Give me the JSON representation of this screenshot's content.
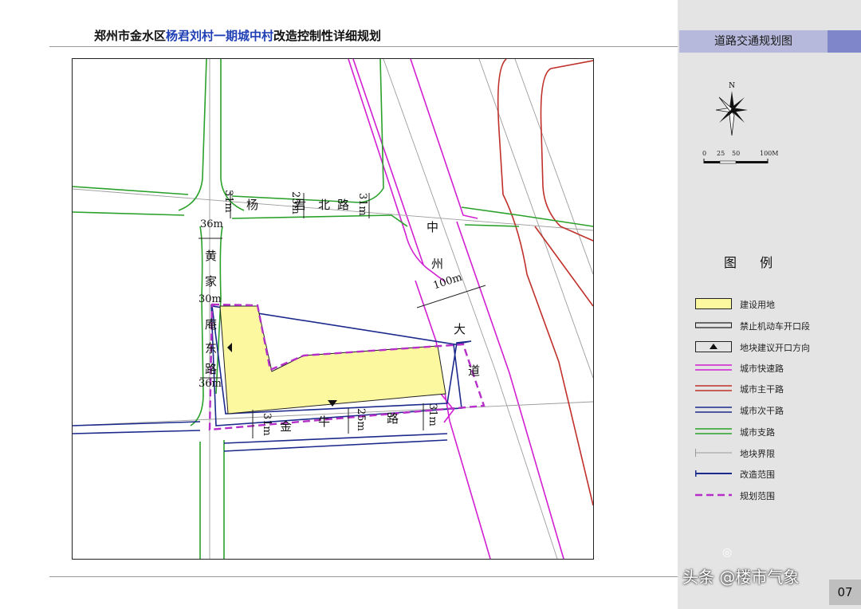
{
  "header": {
    "title_prefix": "郑州市金水区",
    "title_highlight_1": "杨君刘村一期城中村",
    "title_suffix": "改造控制性详细规划"
  },
  "sidebar": {
    "map_title": "道路交通规划图",
    "compass_label": "N",
    "scale": {
      "labels": [
        "0",
        "25",
        "50",
        "100M"
      ]
    },
    "legend_title": "图 例",
    "legend": [
      {
        "label": "建设用地",
        "icon": "yellow-fill"
      },
      {
        "label": "禁止机动车开口段",
        "icon": "double-line-black"
      },
      {
        "label": "地块建议开口方向",
        "icon": "triangle-up"
      },
      {
        "label": "城市快速路",
        "icon": "double-line-magenta"
      },
      {
        "label": "城市主干路",
        "icon": "double-line-red"
      },
      {
        "label": "城市次干路",
        "icon": "double-line-navy"
      },
      {
        "label": "城市支路",
        "icon": "double-line-green"
      },
      {
        "label": "地块界限",
        "icon": "thin-line-gray"
      },
      {
        "label": "改造范围",
        "icon": "blue-line"
      },
      {
        "label": "规划范围",
        "icon": "dashed-magenta"
      }
    ]
  },
  "map": {
    "roads": {
      "yangjun_north": [
        "杨",
        "君",
        "北",
        "路"
      ],
      "zhongzhou": [
        "中",
        "州",
        "大",
        "道"
      ],
      "huangjia": [
        "黄",
        "家",
        "庵",
        "东",
        "路"
      ],
      "jinniu": [
        "金",
        "牛",
        "路"
      ]
    },
    "dimensions": {
      "yangjun_w1": "31m",
      "yangjun_w2": "25m",
      "yangjun_w3": "31m",
      "zhongzhou_w": "100m",
      "huangjia_w1": "36m",
      "huangjia_w2": "30m",
      "huangjia_w3": "36m",
      "jinniu_w1": "31m",
      "jinniu_w2": "25m",
      "jinniu_w3": "31m"
    }
  },
  "footer": {
    "watermark": "头条 @楼市气象",
    "page_number": "07"
  },
  "colors": {
    "expressway": "#d21fd2",
    "arterial": "#c0302a",
    "secondary": "#1c2a8c",
    "branch": "#2aa12a",
    "construction": "#fbf8a0",
    "plan_boundary": "#b62fc9"
  }
}
